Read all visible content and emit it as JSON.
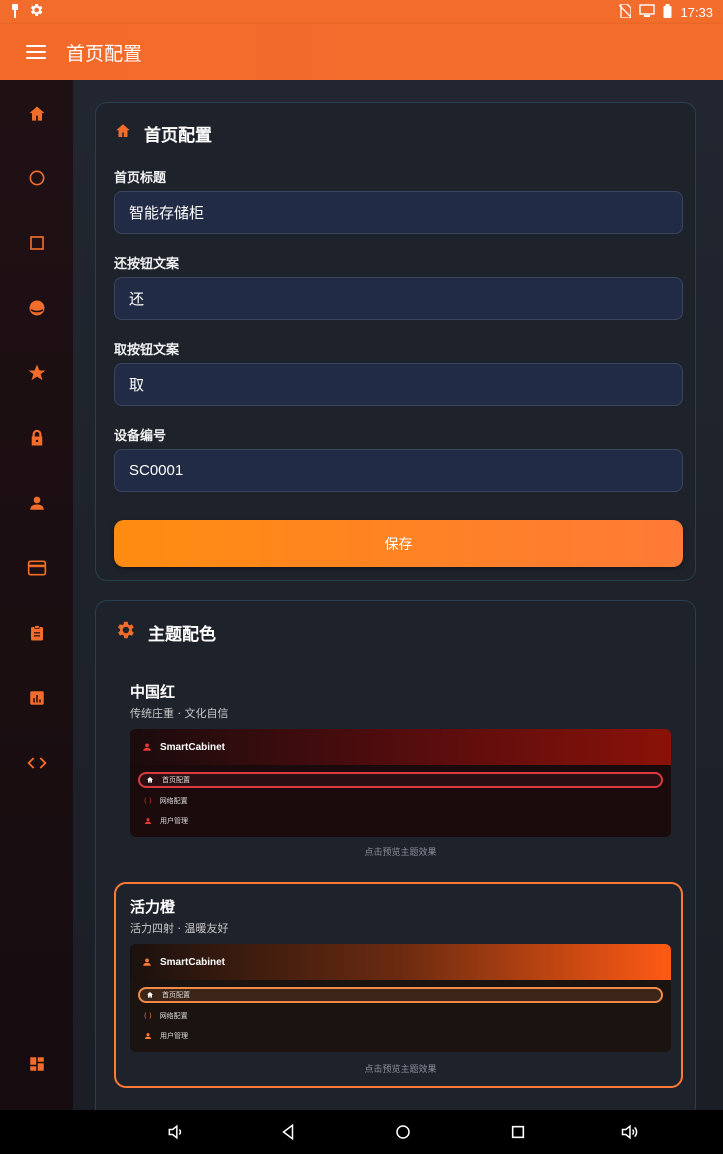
{
  "status": {
    "time": "17:33"
  },
  "appbar": {
    "title": "首页配置"
  },
  "rail": {
    "icons": [
      "home-icon",
      "circle-icon",
      "square-icon",
      "theme-icon",
      "star-icon",
      "lock-icon",
      "person-icon",
      "card-icon",
      "clipboard-icon",
      "chart-icon",
      "code-icon",
      "dashboard-icon"
    ],
    "accent": "#f26c2b"
  },
  "home_config": {
    "title": "首页配置",
    "fields": [
      {
        "label": "首页标题",
        "value": "智能存储柜"
      },
      {
        "label": "还按钮文案",
        "value": "还"
      },
      {
        "label": "取按钮文案",
        "value": "取"
      },
      {
        "label": "设备编号",
        "value": "SC0001"
      }
    ],
    "save_label": "保存"
  },
  "theme_config": {
    "title": "主题配色",
    "themes": [
      {
        "name": "中国红",
        "desc": "传统庄重 · 文化自信",
        "brand": "SmartCabinet",
        "items": [
          "首页配置",
          "网络配置",
          "用户管理"
        ],
        "hint": "点击预览主题效果",
        "selected": false
      },
      {
        "name": "活力橙",
        "desc": "活力四射 · 温暖友好",
        "brand": "SmartCabinet",
        "items": [
          "首页配置",
          "网络配置",
          "用户管理"
        ],
        "hint": "点击预览主题效果",
        "selected": true
      }
    ]
  },
  "navbar": {
    "icons": [
      "volume-down-icon",
      "back-icon",
      "home-nav-icon",
      "recents-icon",
      "volume-up-icon"
    ]
  }
}
